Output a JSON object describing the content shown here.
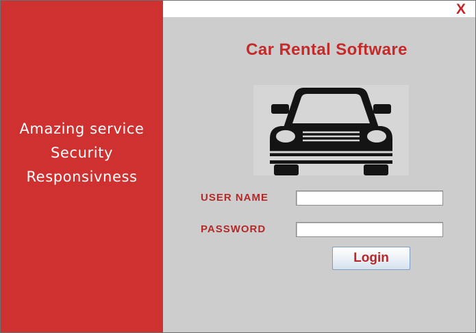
{
  "window": {
    "close_label": "X"
  },
  "sidebar": {
    "slogans": [
      "Amazing service",
      "Security",
      "Responsivness"
    ],
    "background_color": "#cf3131"
  },
  "login": {
    "title": "Car Rental Software",
    "car_icon": "car-front-icon",
    "username_label": "USER NAME",
    "username_value": "",
    "password_label": "PASSWORD",
    "password_value": "",
    "login_button_label": "Login"
  }
}
